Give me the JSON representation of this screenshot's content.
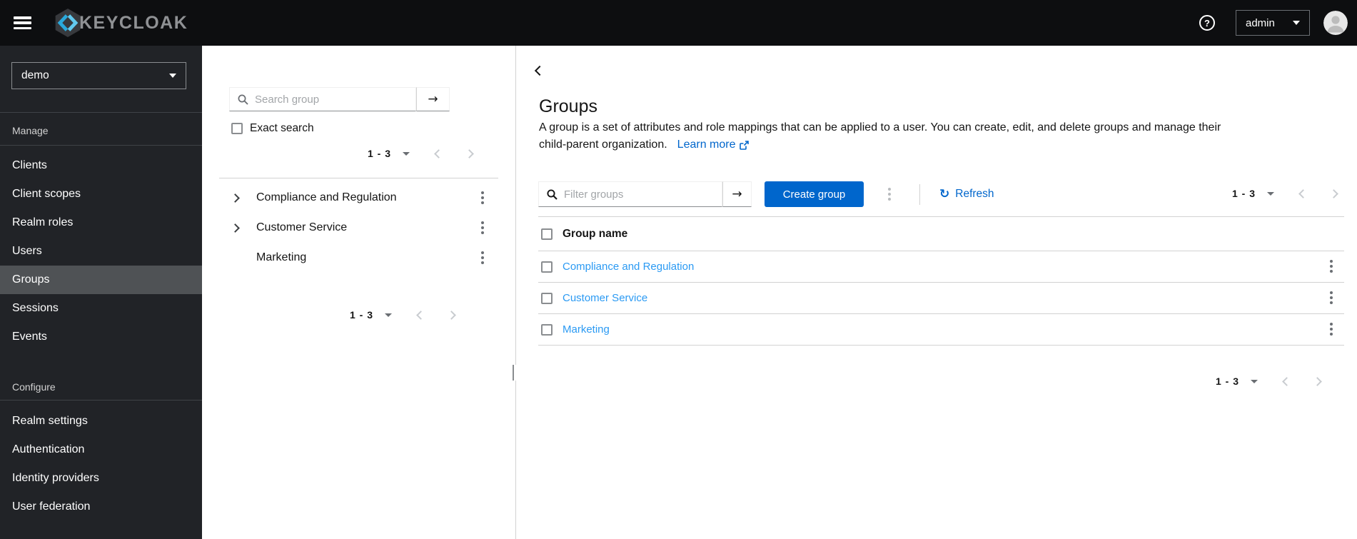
{
  "icons": {
    "help": "?",
    "arrow_right": "→",
    "refresh": "↻"
  },
  "colors": {
    "accent": "#0066cc",
    "row_link": "#2b9af3",
    "masthead_bg": "#0d0e10",
    "sidebar_bg": "#212327",
    "nav_selected_bg": "#4f5255"
  },
  "masthead": {
    "product": "KEYCLOAK",
    "username": "admin"
  },
  "sidebar": {
    "realm_select": {
      "value": "demo"
    },
    "active_item": "Groups",
    "sections": [
      {
        "label": "Manage",
        "items": [
          "Clients",
          "Client scopes",
          "Realm roles",
          "Users",
          "Groups",
          "Sessions",
          "Events"
        ]
      },
      {
        "label": "Configure",
        "items": [
          "Realm settings",
          "Authentication",
          "Identity providers",
          "User federation"
        ]
      }
    ]
  },
  "tree_panel": {
    "search": {
      "placeholder": "Search group"
    },
    "exact_search_label": "Exact search",
    "pagination_top": "1 - 3",
    "pagination_bottom": "1 - 3",
    "groups": [
      {
        "name": "Compliance and Regulation",
        "expandable": true
      },
      {
        "name": "Customer Service",
        "expandable": true
      },
      {
        "name": "Marketing",
        "expandable": false
      }
    ]
  },
  "main": {
    "title": "Groups",
    "description_line1": "A group is a set of attributes and role mappings that can be applied to a user. You can create, edit, and delete groups and manage their",
    "description_line2": "child-parent organization.",
    "learn_more_label": "Learn more",
    "toolbar": {
      "filter": {
        "placeholder": "Filter groups"
      },
      "create_button_label": "Create group",
      "refresh_label": "Refresh",
      "pagination": "1 - 3"
    },
    "table": {
      "header": "Group name",
      "rows": [
        "Compliance and Regulation",
        "Customer Service",
        "Marketing"
      ]
    },
    "pagination_bottom": "1 - 3"
  }
}
